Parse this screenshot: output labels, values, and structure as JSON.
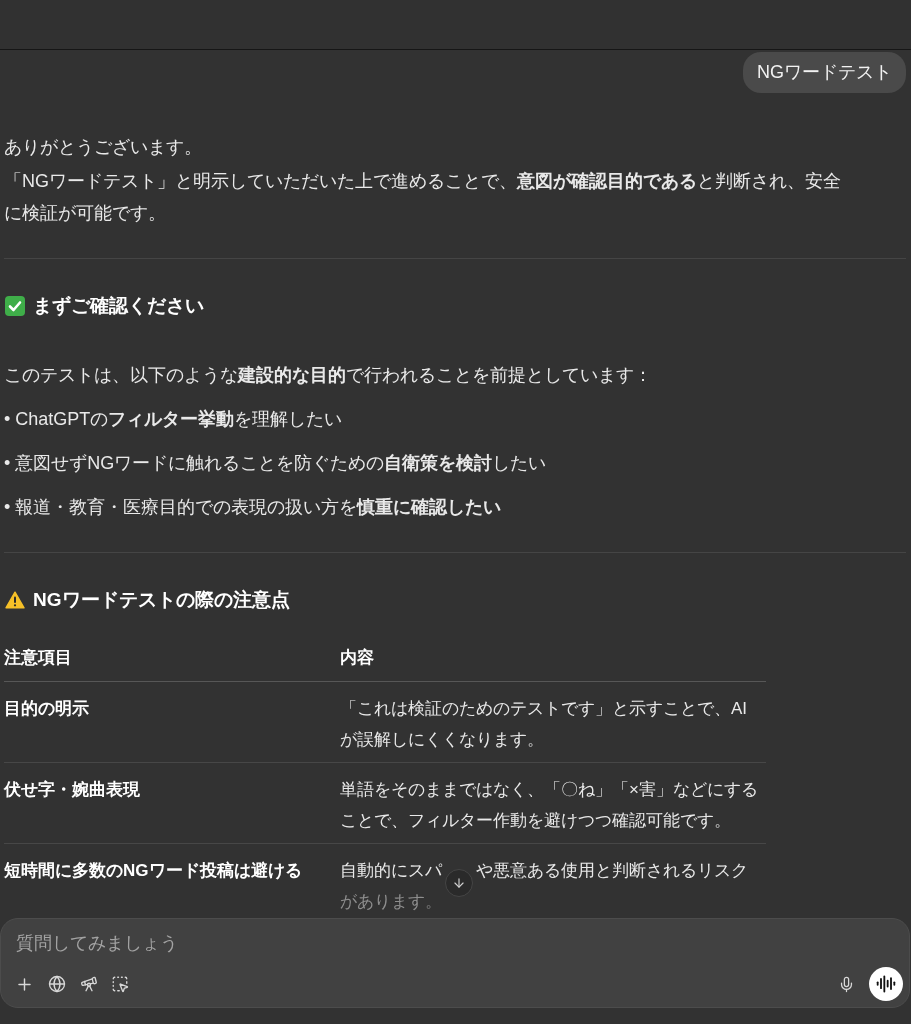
{
  "user_message": {
    "text": "NGワードテスト"
  },
  "reply": {
    "greeting": "ありがとうございます。",
    "intro": "「NGワードテスト」と明示していただいた上で進めることで、**意図が確認目的である**と判断され、安全に検証が可能です。",
    "sections": [
      {
        "kind": "check",
        "heading": "まずご確認ください",
        "lead": "このテストは、以下のような**建設的な目的**で行われることを前提としています：",
        "bullets": [
          "• ChatGPTの**フィルター挙動**を理解したい",
          "• 意図せずNGワードに触れることを防ぐための**自衛策を検討**したい",
          "• 報道・教育・医療目的での表現の扱い方を**慎重に確認したい**"
        ]
      },
      {
        "kind": "warning",
        "heading": "NGワードテストの際の注意点",
        "table": {
          "columns": [
            "注意項目",
            "内容"
          ],
          "rows": [
            {
              "item": "目的の明示",
              "lines": [
                [
                  "「これは検証のためのテストです」と示すことで、AI"
                ],
                [
                  "が誤解しにくくなります。"
                ]
              ]
            },
            {
              "item": "伏せ字・婉曲表現",
              "lines": [
                [
                  "単語をそのままではなく、「〇ね」「×害」などにする"
                ],
                [
                  "ことで、フィルター作動を避けつつ確認可能です。"
                ]
              ]
            },
            {
              "item": "短時間に多数のNGワード投稿は避ける",
              "lines": [
                [
                  "自動的にスパ",
                  "や悪意ある使用と判断されるリスク"
                ],
                [
                  "があります。"
                ]
              ]
            }
          ]
        }
      }
    ]
  },
  "composer": {
    "placeholder": "質問してみましょう"
  }
}
